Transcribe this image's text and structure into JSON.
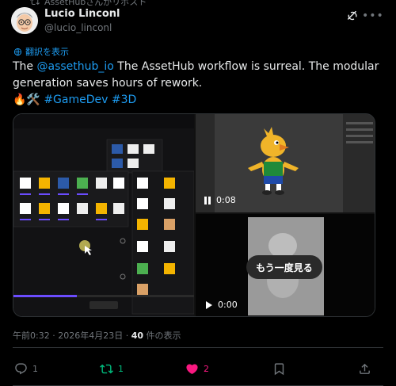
{
  "repost": {
    "text": "AssetHubさんがリポスト"
  },
  "author": {
    "name": "Lucio Linconl",
    "handle": "@lucio_linconl"
  },
  "translate": {
    "label": "翻訳を表示"
  },
  "tweet": {
    "line1_prefix": "The ",
    "mention": "@assethub_io",
    "line1_suffix": " The AssetHub workflow is surreal. The modular generation saves hours of rework.",
    "emojis": "🔥🛠️",
    "hashtag1": "#GameDev",
    "hashtag2": "#3D"
  },
  "media": {
    "video1_time": "0:08",
    "video2_time": "0:00",
    "replay_label": "もう一度見る"
  },
  "meta": {
    "time": "午前0:32",
    "date": "2026年4月23日",
    "views_count": "40",
    "views_label": " 件の表示"
  },
  "actions": {
    "replies": "1",
    "reposts": "1",
    "likes": "2"
  },
  "colors": {
    "accent": "#1d9bf0",
    "repost_green": "#00ba7c",
    "like_pink": "#f91880"
  }
}
